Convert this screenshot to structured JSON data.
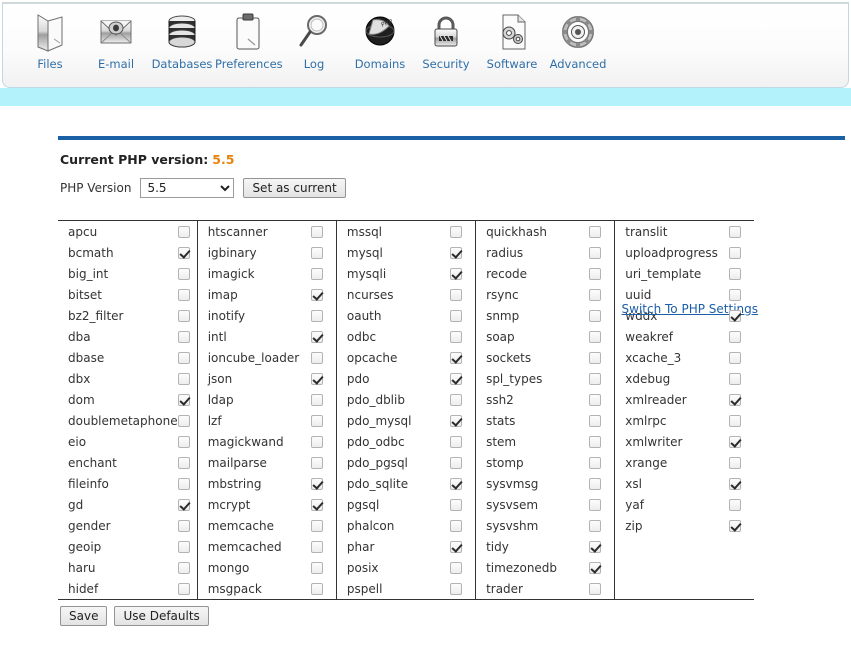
{
  "topnav": {
    "items": [
      {
        "label": "Files",
        "icon": "folder-icon"
      },
      {
        "label": "E-mail",
        "icon": "envelope-icon"
      },
      {
        "label": "Databases",
        "icon": "database-icon"
      },
      {
        "label": "Preferences",
        "icon": "clipboard-icon"
      },
      {
        "label": "Log",
        "icon": "magnifier-icon"
      },
      {
        "label": "Domains",
        "icon": "globe-icon"
      },
      {
        "label": "Security",
        "icon": "padlock-icon"
      },
      {
        "label": "Software",
        "icon": "gear-page-icon"
      },
      {
        "label": "Advanced",
        "icon": "gear-icon"
      }
    ]
  },
  "php": {
    "current_label": "Current PHP version:",
    "current_value": "5.5",
    "version_label": "PHP Version",
    "selected_version": "5.5",
    "version_options": [
      "5.5"
    ],
    "set_as_current_label": "Set as current",
    "switch_link_label": "Switch To PHP Settings",
    "accent_color": "#e8830c",
    "rule_color": "#1b5fa5",
    "link_color": "#1c5fa8"
  },
  "buttons": {
    "save_label": "Save",
    "use_defaults_label": "Use Defaults"
  },
  "extensions": {
    "columns": [
      [
        {
          "name": "apcu",
          "checked": false
        },
        {
          "name": "bcmath",
          "checked": true
        },
        {
          "name": "big_int",
          "checked": false
        },
        {
          "name": "bitset",
          "checked": false
        },
        {
          "name": "bz2_filter",
          "checked": false
        },
        {
          "name": "dba",
          "checked": false
        },
        {
          "name": "dbase",
          "checked": false
        },
        {
          "name": "dbx",
          "checked": false
        },
        {
          "name": "dom",
          "checked": true
        },
        {
          "name": "doublemetaphone",
          "checked": false
        },
        {
          "name": "eio",
          "checked": false
        },
        {
          "name": "enchant",
          "checked": false
        },
        {
          "name": "fileinfo",
          "checked": false
        },
        {
          "name": "gd",
          "checked": true
        },
        {
          "name": "gender",
          "checked": false
        },
        {
          "name": "geoip",
          "checked": false
        },
        {
          "name": "haru",
          "checked": false
        },
        {
          "name": "hidef",
          "checked": false
        }
      ],
      [
        {
          "name": "htscanner",
          "checked": false
        },
        {
          "name": "igbinary",
          "checked": false
        },
        {
          "name": "imagick",
          "checked": false
        },
        {
          "name": "imap",
          "checked": true
        },
        {
          "name": "inotify",
          "checked": false
        },
        {
          "name": "intl",
          "checked": true
        },
        {
          "name": "ioncube_loader",
          "checked": false
        },
        {
          "name": "json",
          "checked": true
        },
        {
          "name": "ldap",
          "checked": false
        },
        {
          "name": "lzf",
          "checked": false
        },
        {
          "name": "magickwand",
          "checked": false
        },
        {
          "name": "mailparse",
          "checked": false
        },
        {
          "name": "mbstring",
          "checked": true
        },
        {
          "name": "mcrypt",
          "checked": true
        },
        {
          "name": "memcache",
          "checked": false
        },
        {
          "name": "memcached",
          "checked": false
        },
        {
          "name": "mongo",
          "checked": false
        },
        {
          "name": "msgpack",
          "checked": false
        }
      ],
      [
        {
          "name": "mssql",
          "checked": false
        },
        {
          "name": "mysql",
          "checked": true
        },
        {
          "name": "mysqli",
          "checked": true
        },
        {
          "name": "ncurses",
          "checked": false
        },
        {
          "name": "oauth",
          "checked": false
        },
        {
          "name": "odbc",
          "checked": false
        },
        {
          "name": "opcache",
          "checked": true
        },
        {
          "name": "pdo",
          "checked": true
        },
        {
          "name": "pdo_dblib",
          "checked": false
        },
        {
          "name": "pdo_mysql",
          "checked": true
        },
        {
          "name": "pdo_odbc",
          "checked": false
        },
        {
          "name": "pdo_pgsql",
          "checked": false
        },
        {
          "name": "pdo_sqlite",
          "checked": true
        },
        {
          "name": "pgsql",
          "checked": false
        },
        {
          "name": "phalcon",
          "checked": false
        },
        {
          "name": "phar",
          "checked": true
        },
        {
          "name": "posix",
          "checked": false
        },
        {
          "name": "pspell",
          "checked": false
        }
      ],
      [
        {
          "name": "quickhash",
          "checked": false
        },
        {
          "name": "radius",
          "checked": false
        },
        {
          "name": "recode",
          "checked": false
        },
        {
          "name": "rsync",
          "checked": false
        },
        {
          "name": "snmp",
          "checked": false
        },
        {
          "name": "soap",
          "checked": false
        },
        {
          "name": "sockets",
          "checked": false
        },
        {
          "name": "spl_types",
          "checked": false
        },
        {
          "name": "ssh2",
          "checked": false
        },
        {
          "name": "stats",
          "checked": false
        },
        {
          "name": "stem",
          "checked": false
        },
        {
          "name": "stomp",
          "checked": false
        },
        {
          "name": "sysvmsg",
          "checked": false
        },
        {
          "name": "sysvsem",
          "checked": false
        },
        {
          "name": "sysvshm",
          "checked": false
        },
        {
          "name": "tidy",
          "checked": true
        },
        {
          "name": "timezonedb",
          "checked": true
        },
        {
          "name": "trader",
          "checked": false
        }
      ],
      [
        {
          "name": "translit",
          "checked": false
        },
        {
          "name": "uploadprogress",
          "checked": false
        },
        {
          "name": "uri_template",
          "checked": false
        },
        {
          "name": "uuid",
          "checked": false
        },
        {
          "name": "wddx",
          "checked": true
        },
        {
          "name": "weakref",
          "checked": false
        },
        {
          "name": "xcache_3",
          "checked": false
        },
        {
          "name": "xdebug",
          "checked": false
        },
        {
          "name": "xmlreader",
          "checked": true
        },
        {
          "name": "xmlrpc",
          "checked": false
        },
        {
          "name": "xmlwriter",
          "checked": true
        },
        {
          "name": "xrange",
          "checked": false
        },
        {
          "name": "xsl",
          "checked": true
        },
        {
          "name": "yaf",
          "checked": false
        },
        {
          "name": "zip",
          "checked": true
        }
      ]
    ]
  }
}
